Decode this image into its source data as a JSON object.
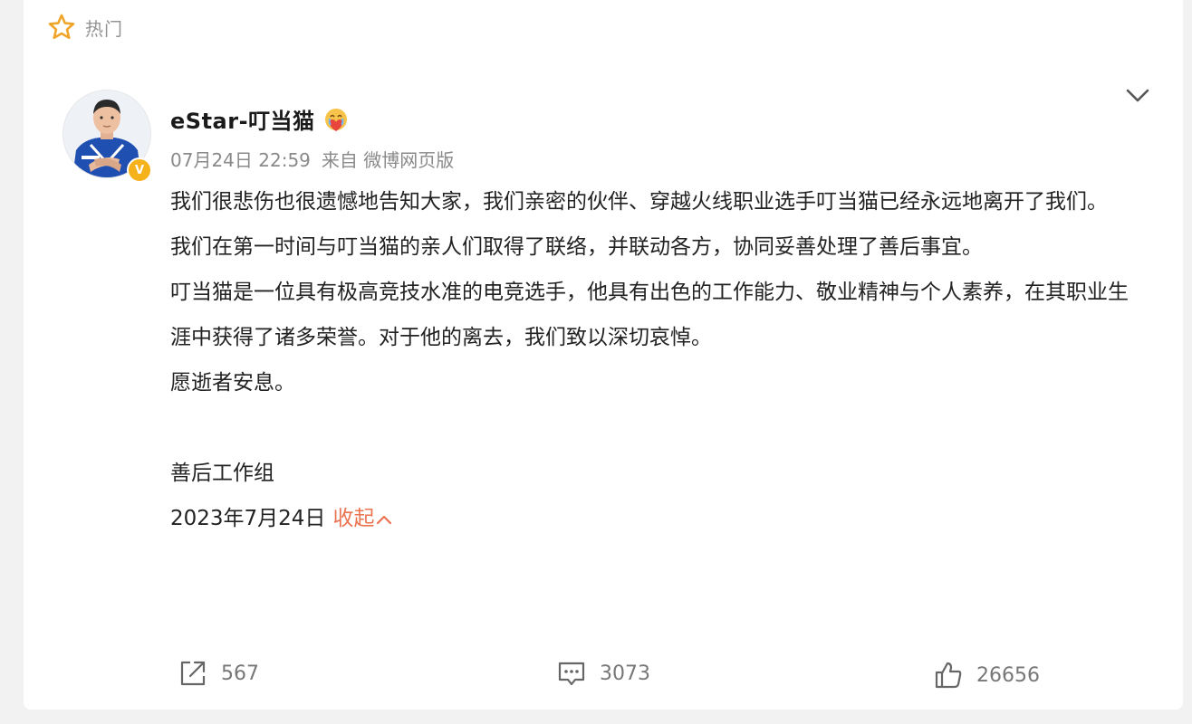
{
  "header": {
    "hot_label": "热门",
    "hot_icon": "star-outline-icon"
  },
  "post": {
    "author": {
      "name": "eStar-叮当猫",
      "verified": true,
      "verified_badge": "V",
      "badge_icon": "crying-heart-emoji-icon",
      "avatar": "avatar-player-blue-jersey"
    },
    "time": "07月24日 22:59",
    "source": "来自 微博网页版",
    "paragraphs": [
      "我们很悲伤也很遗憾地告知大家，我们亲密的伙伴、穿越火线职业选手叮当猫已经永远地离开了我们。",
      "我们在第一时间与叮当猫的亲人们取得了联络，并联动各方，协同妥善处理了善后事宜。",
      "叮当猫是一位具有极高竞技水准的电竞选手，他具有出色的工作能力、敬业精神与个人素养，在其职业生涯中获得了诸多荣誉。对于他的离去，我们致以深切哀悼。",
      "愿逝者安息。"
    ],
    "signature": "善后工作组",
    "date": "2023年7月24日",
    "collapse_label": "收起"
  },
  "actions": {
    "repost_count": "567",
    "comment_count": "3073",
    "like_count": "26656"
  },
  "colors": {
    "accent": "#eb7350",
    "verified": "#f6b21a",
    "meta_text": "#8a8a8a"
  }
}
